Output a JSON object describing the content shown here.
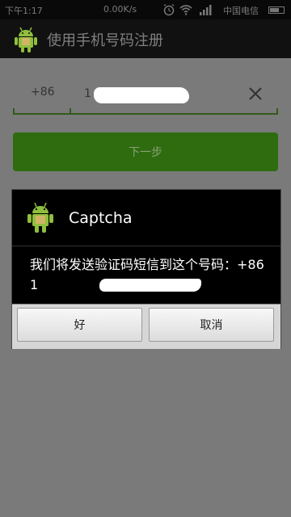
{
  "status_bar": {
    "time": "下午1:17",
    "net_speed": "0.00K/s",
    "carrier": "中国电信",
    "battery_level": 0.7,
    "icons": [
      "alarm-icon",
      "wifi-icon",
      "signal-icon",
      "battery-icon"
    ]
  },
  "title_bar": {
    "title": "使用手机号码注册",
    "icon": "android-icon"
  },
  "phone_form": {
    "country_code": "+86",
    "phone_value": "1",
    "clear_icon": "close-icon"
  },
  "next_button": {
    "label": "下一步"
  },
  "dialog": {
    "title": "Captcha",
    "message": "我们将发送验证码短信到这个号码：+86 1",
    "confirm_label": "好",
    "cancel_label": "取消"
  },
  "colors": {
    "accent": "#2e6c0f",
    "overlay": "#7a7a7a",
    "dialog_background": "#000000",
    "title_bar": "#111111"
  }
}
